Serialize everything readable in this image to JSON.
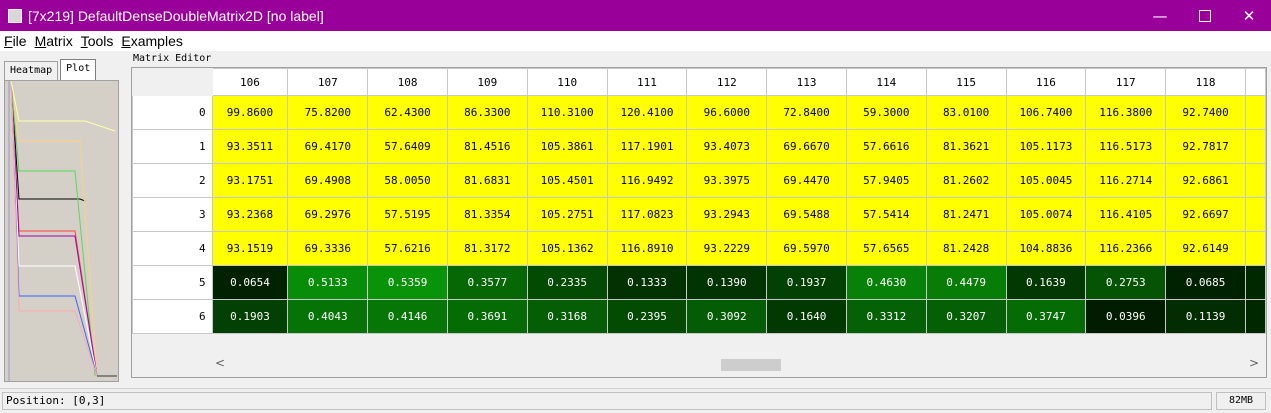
{
  "window": {
    "title": "[7x219] DefaultDenseDoubleMatrix2D [no label]",
    "accent": "#990099",
    "minimize_glyph": "—",
    "close_glyph": "✕"
  },
  "menu": [
    {
      "label": "File",
      "mnemonic": "F",
      "rest": "ile"
    },
    {
      "label": "Matrix",
      "mnemonic": "M",
      "rest": "atrix"
    },
    {
      "label": "Tools",
      "mnemonic": "T",
      "rest": "ools"
    },
    {
      "label": "Examples",
      "mnemonic": "E",
      "rest": "xamples"
    }
  ],
  "left_panel": {
    "tabs": [
      {
        "label": "Heatmap",
        "active": false
      },
      {
        "label": "Plot",
        "active": true
      }
    ]
  },
  "editor": {
    "title": "Matrix Editor",
    "columns": [
      "106",
      "107",
      "108",
      "109",
      "110",
      "111",
      "112",
      "113",
      "114",
      "115",
      "116",
      "117",
      "118"
    ],
    "rows": [
      {
        "label": "0",
        "cells": [
          "99.8600",
          "75.8200",
          "62.4300",
          "86.3300",
          "110.3100",
          "120.4100",
          "96.6000",
          "72.8400",
          "59.3000",
          "83.0100",
          "106.7400",
          "116.3800",
          "92.7400"
        ]
      },
      {
        "label": "1",
        "cells": [
          "93.3511",
          "69.4170",
          "57.6409",
          "81.4516",
          "105.3861",
          "117.1901",
          "93.4073",
          "69.6670",
          "57.6616",
          "81.3621",
          "105.1173",
          "116.5173",
          "92.7817"
        ]
      },
      {
        "label": "2",
        "cells": [
          "93.1751",
          "69.4908",
          "58.0050",
          "81.6831",
          "105.4501",
          "116.9492",
          "93.3975",
          "69.4470",
          "57.9405",
          "81.2602",
          "105.0045",
          "116.2714",
          "92.6861"
        ]
      },
      {
        "label": "3",
        "cells": [
          "93.2368",
          "69.2976",
          "57.5195",
          "81.3354",
          "105.2751",
          "117.0823",
          "93.2943",
          "69.5488",
          "57.5414",
          "81.2471",
          "105.0074",
          "116.4105",
          "92.6697"
        ]
      },
      {
        "label": "4",
        "cells": [
          "93.1519",
          "69.3336",
          "57.6216",
          "81.3172",
          "105.1362",
          "116.8910",
          "93.2229",
          "69.5970",
          "57.6565",
          "81.2428",
          "104.8836",
          "116.2366",
          "92.6149"
        ]
      },
      {
        "label": "5",
        "cells": [
          "0.0654",
          "0.5133",
          "0.5359",
          "0.3577",
          "0.2335",
          "0.1333",
          "0.1390",
          "0.1937",
          "0.4630",
          "0.4479",
          "0.1639",
          "0.2753",
          "0.0685"
        ]
      },
      {
        "label": "6",
        "cells": [
          "0.1903",
          "0.4043",
          "0.4146",
          "0.3691",
          "0.3168",
          "0.2395",
          "0.3092",
          "0.1640",
          "0.3312",
          "0.3207",
          "0.3747",
          "0.0396",
          "0.1139"
        ]
      }
    ]
  },
  "status": {
    "position": "Position: [0,3]",
    "memory": "82MB"
  }
}
